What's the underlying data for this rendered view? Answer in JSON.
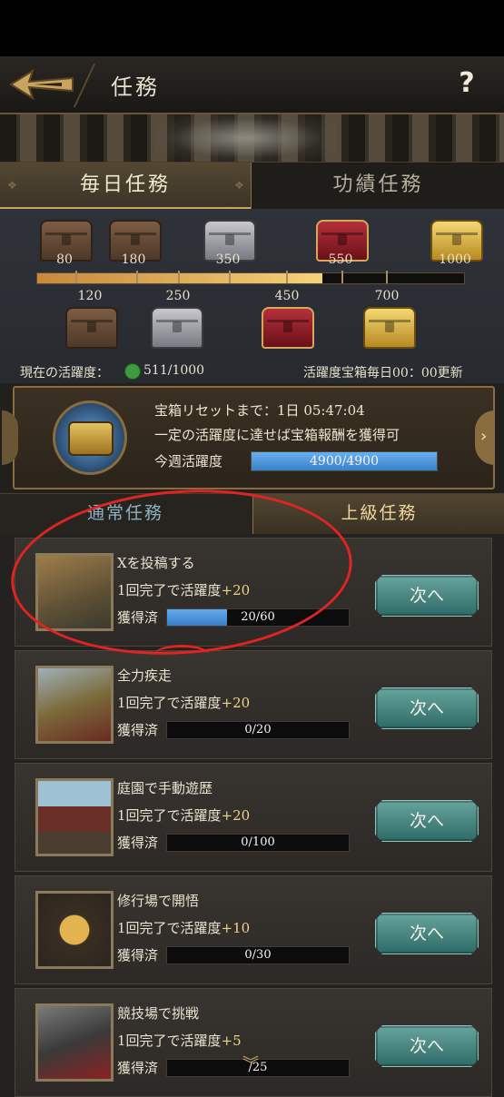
{
  "header": {
    "title": "任務",
    "help_label": "?"
  },
  "tabs": {
    "daily": "毎日任務",
    "merit": "功績任務"
  },
  "activity": {
    "top_chests": [
      {
        "value": "80",
        "type": "wood"
      },
      {
        "value": "180",
        "type": "wood"
      },
      {
        "value": "350",
        "type": "silver"
      },
      {
        "value": "550",
        "type": "red"
      },
      {
        "value": "1000",
        "type": "gold"
      }
    ],
    "bottom_chests": [
      {
        "value": "120",
        "type": "wood"
      },
      {
        "value": "250",
        "type": "silver"
      },
      {
        "value": "450",
        "type": "red"
      },
      {
        "value": "700",
        "type": "gold"
      }
    ],
    "progress_fraction": 0.668,
    "current_label": "現在の活躍度：",
    "current_value": "511/1000",
    "reset_note": "活躍度宝箱毎日00：00更新"
  },
  "weekly": {
    "reset_time": "宝箱リセットまで：1日 05:47:04",
    "description": "一定の活躍度に達せば宝箱報酬を獲得可",
    "label": "今週活躍度",
    "value": "4900/4900",
    "fraction": 1.0
  },
  "subtabs": {
    "normal": "通常任務",
    "advanced": "上級任務"
  },
  "tasks": [
    {
      "name": "Xを投稿する",
      "reward_prefix": "1回完了で活躍度",
      "reward_plus": "+20",
      "status": "獲得済",
      "progress": "20/60",
      "fraction": 0.33,
      "button": "次へ"
    },
    {
      "name": "全力疾走",
      "reward_prefix": "1回完了で活躍度",
      "reward_plus": "+20",
      "status": "獲得済",
      "progress": "0/20",
      "fraction": 0,
      "button": "次へ"
    },
    {
      "name": "庭園で手動遊歴",
      "reward_prefix": "1回完了で活躍度",
      "reward_plus": "+20",
      "status": "獲得済",
      "progress": "0/100",
      "fraction": 0,
      "button": "次へ"
    },
    {
      "name": "修行場で開悟",
      "reward_prefix": "1回完了で活躍度",
      "reward_plus": "+10",
      "status": "獲得済",
      "progress": "0/30",
      "fraction": 0,
      "button": "次へ"
    },
    {
      "name": "競技場で挑戦",
      "reward_prefix": "1回完了で活躍度",
      "reward_plus": "+5",
      "status": "獲得済",
      "progress": "/25",
      "fraction": 0,
      "button": "次へ"
    }
  ],
  "colors": {
    "accent_gold": "#c9a45e",
    "progress_blue": "#3a80c8",
    "button_teal": "#2f6b66",
    "annotation_red": "#e02424"
  }
}
